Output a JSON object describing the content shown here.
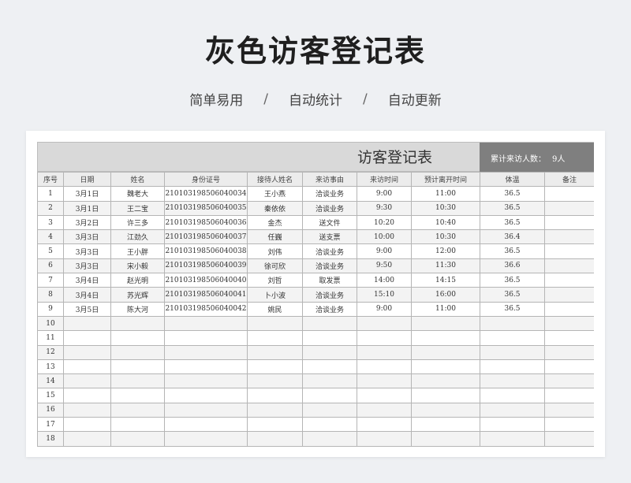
{
  "page": {
    "title": "灰色访客登记表",
    "tags": [
      "简单易用",
      "自动统计",
      "自动更新"
    ],
    "separator": "/"
  },
  "sheet": {
    "title": "访客登记表",
    "count_label": "累计来访人数：",
    "count_value": "9人",
    "columns": [
      "序号",
      "日期",
      "姓名",
      "身份证号",
      "接待人姓名",
      "来访事由",
      "来访时间",
      "预计离开时间",
      "体温",
      "备注"
    ],
    "rows": [
      [
        "1",
        "3月1日",
        "魏老大",
        "210103198506040034",
        "王小燕",
        "洽谈业务",
        "9:00",
        "11:00",
        "36.5",
        ""
      ],
      [
        "2",
        "3月1日",
        "王二宝",
        "210103198506040035",
        "秦依依",
        "洽谈业务",
        "9:30",
        "10:30",
        "36.5",
        ""
      ],
      [
        "3",
        "3月2日",
        "许三多",
        "210103198506040036",
        "金杰",
        "送文件",
        "10:20",
        "10:40",
        "36.5",
        ""
      ],
      [
        "4",
        "3月3日",
        "江劲久",
        "210103198506040037",
        "任巍",
        "送支票",
        "10:00",
        "10:30",
        "36.4",
        ""
      ],
      [
        "5",
        "3月3日",
        "王小胖",
        "210103198506040038",
        "刘伟",
        "洽谈业务",
        "9:00",
        "12:00",
        "36.5",
        ""
      ],
      [
        "6",
        "3月3日",
        "宋小毅",
        "210103198506040039",
        "徐可欣",
        "洽谈业务",
        "9:50",
        "11:30",
        "36.6",
        ""
      ],
      [
        "7",
        "3月4日",
        "赵光明",
        "210103198506040040",
        "刘哲",
        "取发票",
        "14:00",
        "14:15",
        "36.5",
        ""
      ],
      [
        "8",
        "3月4日",
        "苏光辉",
        "210103198506040041",
        "卜小波",
        "洽谈业务",
        "15:10",
        "16:00",
        "36.5",
        ""
      ],
      [
        "9",
        "3月5日",
        "陈大河",
        "210103198506040042",
        "姚民",
        "洽谈业务",
        "9:00",
        "11:00",
        "36.5",
        ""
      ],
      [
        "10",
        "",
        "",
        "",
        "",
        "",
        "",
        "",
        "",
        ""
      ],
      [
        "11",
        "",
        "",
        "",
        "",
        "",
        "",
        "",
        "",
        ""
      ],
      [
        "12",
        "",
        "",
        "",
        "",
        "",
        "",
        "",
        "",
        ""
      ],
      [
        "13",
        "",
        "",
        "",
        "",
        "",
        "",
        "",
        "",
        ""
      ],
      [
        "14",
        "",
        "",
        "",
        "",
        "",
        "",
        "",
        "",
        ""
      ],
      [
        "15",
        "",
        "",
        "",
        "",
        "",
        "",
        "",
        "",
        ""
      ],
      [
        "16",
        "",
        "",
        "",
        "",
        "",
        "",
        "",
        "",
        ""
      ],
      [
        "17",
        "",
        "",
        "",
        "",
        "",
        "",
        "",
        "",
        ""
      ],
      [
        "18",
        "",
        "",
        "",
        "",
        "",
        "",
        "",
        "",
        ""
      ]
    ]
  },
  "colors": {
    "page_bg": "#eef0f3",
    "header_band": "#d9d9d9",
    "count_box": "#7f7f7f",
    "grid_line": "#b5b5b5"
  }
}
